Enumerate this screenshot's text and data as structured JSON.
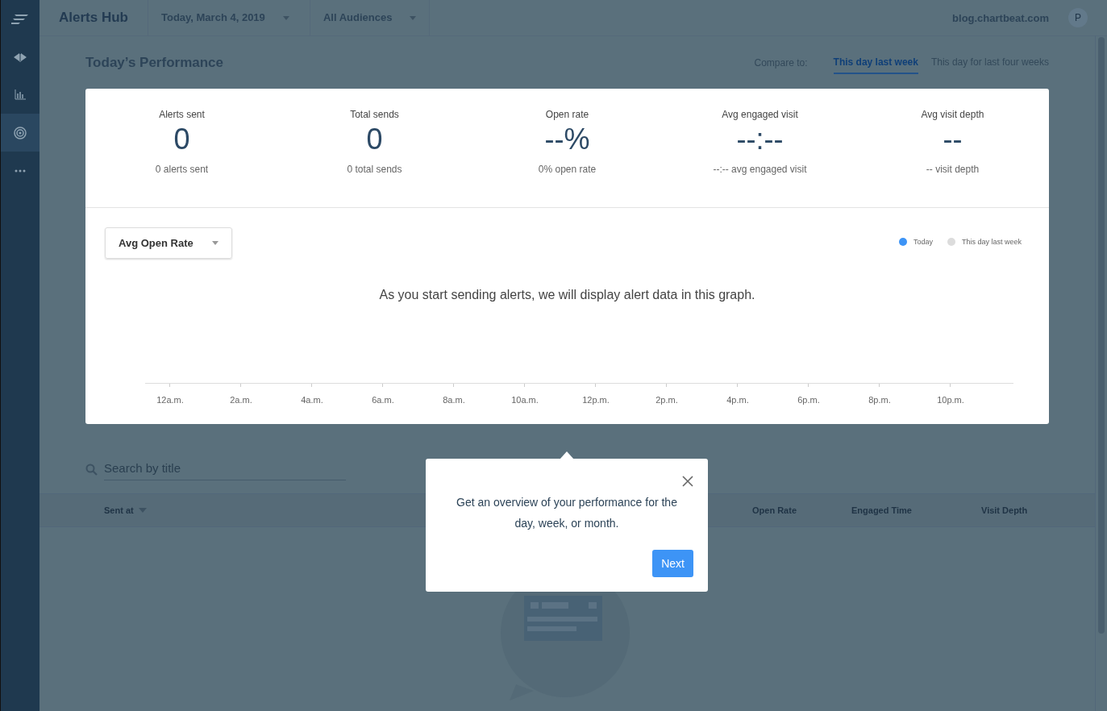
{
  "sidebar": {
    "items": [
      {
        "kind": "logo",
        "selected": false
      },
      {
        "kind": "megaphone",
        "selected": false
      },
      {
        "kind": "chart",
        "selected": false
      },
      {
        "kind": "target",
        "selected": true
      },
      {
        "kind": "more",
        "selected": false
      }
    ]
  },
  "topbar": {
    "title": "Alerts Hub",
    "date_filter": "Today, March 4, 2019",
    "audience_filter": "All Audiences",
    "site": "blog.chartbeat.com",
    "avatar": "P"
  },
  "performance": {
    "title": "Today’s Performance",
    "compare_label": "Compare to:",
    "compare_tabs": [
      {
        "label": "This day last week",
        "selected": true
      },
      {
        "label": "This day for last four weeks",
        "selected": false
      }
    ]
  },
  "stats": [
    {
      "label": "Alerts sent",
      "value": "0",
      "caption": "0 alerts sent"
    },
    {
      "label": "Total sends",
      "value": "0",
      "caption": "0 total sends"
    },
    {
      "label": "Open rate",
      "value": "--%",
      "caption": "0% open rate"
    },
    {
      "label": "Avg engaged visit",
      "value": "--:--",
      "caption": "--:-- avg engaged visit"
    },
    {
      "label": "Avg visit depth",
      "value": "--",
      "caption": "-- visit depth"
    }
  ],
  "graph": {
    "metric_dropdown": "Avg Open Rate",
    "legend": [
      {
        "label": "Today",
        "color": "#3d94f6"
      },
      {
        "label": "This day last week",
        "color": "#dcdcdc"
      }
    ],
    "empty_message": "As you start sending alerts, we will display alert data in this graph.",
    "x_labels": [
      "12a.m.",
      "2a.m.",
      "4a.m.",
      "6a.m.",
      "8a.m.",
      "10a.m.",
      "12p.m.",
      "2p.m.",
      "4p.m.",
      "6p.m.",
      "8p.m.",
      "10p.m."
    ]
  },
  "search": {
    "placeholder": "Search by title"
  },
  "table": {
    "columns": [
      {
        "label": "Sent at",
        "sorted": true
      },
      {
        "label": "Open Rate",
        "sorted": false
      },
      {
        "label": "Engaged Time",
        "sorted": false
      },
      {
        "label": "Visit Depth",
        "sorted": false
      }
    ]
  },
  "tooltip": {
    "text": "Get an overview of your performance for the day, week, or month.",
    "button": "Next"
  }
}
